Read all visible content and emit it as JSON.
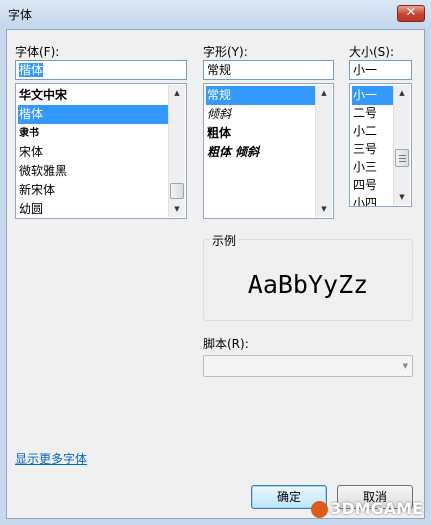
{
  "window": {
    "title": "字体"
  },
  "font": {
    "label": "字体(F):",
    "value": "楷体",
    "items": [
      "华文中宋",
      "楷体",
      "隶书",
      "宋体",
      "微软雅黑",
      "新宋体",
      "幼圆"
    ],
    "selected_index": 1
  },
  "style": {
    "label": "字形(Y):",
    "value": "常规",
    "items": [
      "常规",
      "倾斜",
      "粗体",
      "粗体 倾斜"
    ],
    "selected_index": 0
  },
  "size": {
    "label": "大小(S):",
    "value": "小一",
    "items": [
      "小一",
      "二号",
      "小二",
      "三号",
      "小三",
      "四号",
      "小四"
    ],
    "selected_index": 0
  },
  "sample": {
    "label": "示例",
    "text": "AaBbYyZz"
  },
  "script": {
    "label": "脚本(R):",
    "value": ""
  },
  "more_fonts_link": "显示更多字体",
  "buttons": {
    "ok": "确定",
    "cancel": "取消"
  },
  "watermark": "3DMGAME"
}
